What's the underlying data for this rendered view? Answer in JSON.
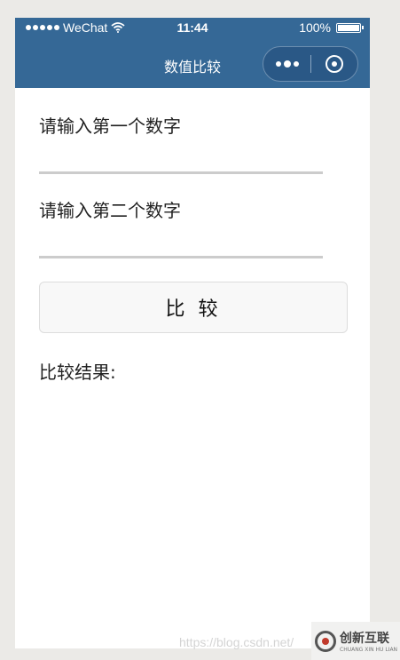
{
  "status_bar": {
    "carrier": "WeChat",
    "time": "11:44",
    "battery": "100%"
  },
  "nav": {
    "title": "数值比较"
  },
  "form": {
    "label_first": "请输入第一个数字",
    "value_first": "",
    "label_second": "请输入第二个数字",
    "value_second": "",
    "compare_label": "比 较",
    "result_label": "比较结果:"
  },
  "watermark": "https://blog.csdn.net/",
  "logo": {
    "name_cn": "创新互联",
    "name_en": "CHUANG XIN HU LIAN"
  },
  "colors": {
    "nav_bg": "#356896",
    "page_bg": "#ebeae7"
  }
}
